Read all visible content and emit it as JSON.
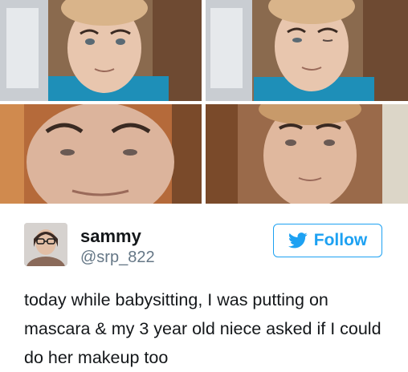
{
  "tweet": {
    "display_name": "sammy",
    "handle": "@srp_822",
    "follow_label": "Follow",
    "text": "today while babysitting, I was putting on mascara & my 3 year old niece asked if I could do her makeup too"
  },
  "icons": {
    "follow": "twitter-bird-icon"
  },
  "colors": {
    "accent": "#1da1f2",
    "text": "#14171a",
    "muted": "#657786"
  }
}
